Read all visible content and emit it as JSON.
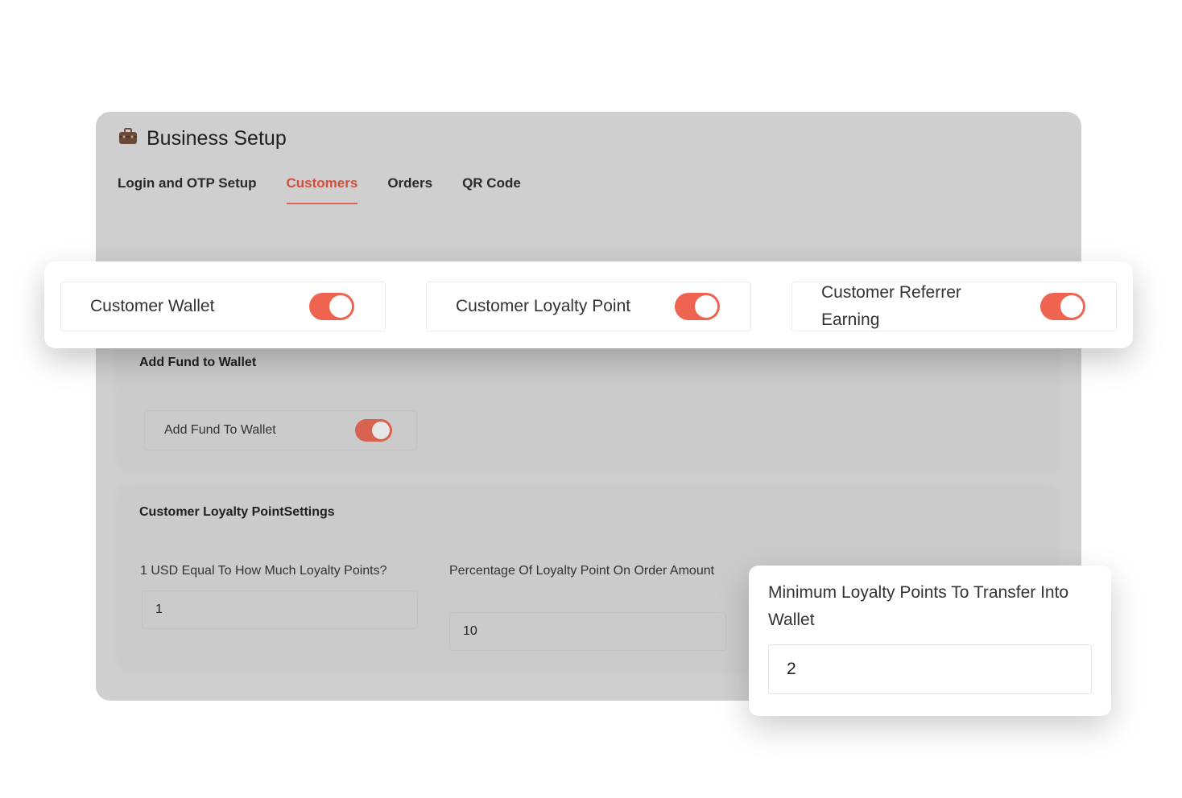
{
  "header": {
    "title": "Business Setup",
    "icon": "briefcase-icon"
  },
  "tabs": [
    {
      "label": "Login and OTP Setup",
      "active": false
    },
    {
      "label": "Customers",
      "active": true
    },
    {
      "label": "Orders",
      "active": false
    },
    {
      "label": "QR Code",
      "active": false
    }
  ],
  "colors": {
    "accent": "#e4604f",
    "toggle_on": "#ef6450"
  },
  "toggles": [
    {
      "label": "Customer Wallet",
      "on": true
    },
    {
      "label": "Customer Loyalty Point",
      "on": true
    },
    {
      "label": "Customer Referrer Earning",
      "on": true
    }
  ],
  "wallet_section": {
    "title": "Add Fund to Wallet",
    "toggle_label": "Add Fund To Wallet",
    "toggle_on": true
  },
  "loyalty_section": {
    "title": "Customer Loyalty PointSettings",
    "fields": [
      {
        "label": "1 USD Equal To How Much Loyalty Points?",
        "value": "1"
      },
      {
        "label": "Percentage Of Loyalty Point On Order Amount",
        "value": "10"
      },
      {
        "label": "Minimum Loyalty Points To Transfer Into Wallet",
        "value": "2"
      }
    ]
  }
}
